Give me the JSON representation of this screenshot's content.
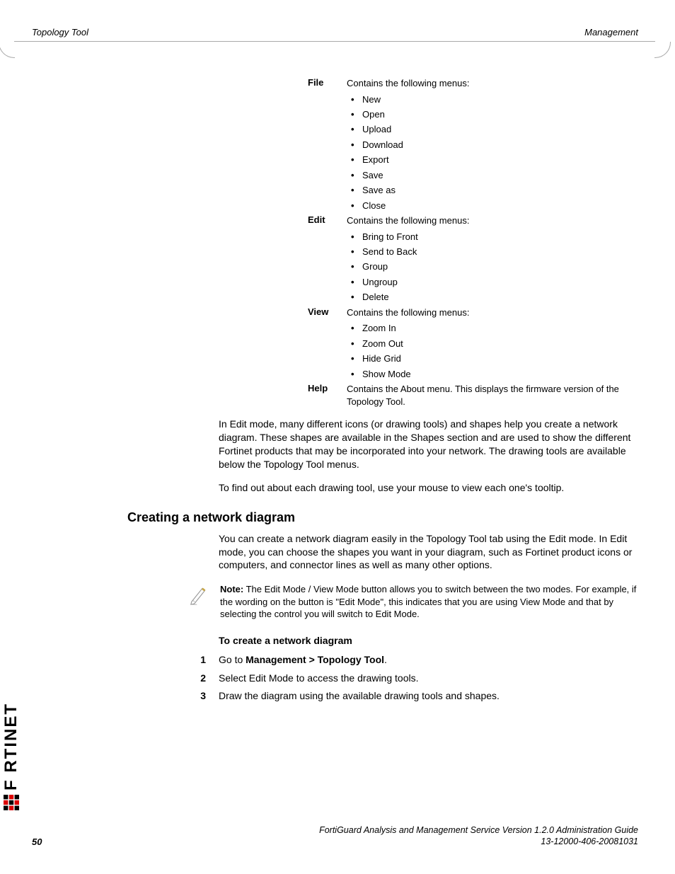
{
  "header": {
    "left": "Topology Tool",
    "right": "Management"
  },
  "menus": [
    {
      "name": "File",
      "intro": "Contains the following menus:",
      "items": [
        "New",
        "Open",
        "Upload",
        "Download",
        "Export",
        "Save",
        "Save as",
        "Close"
      ]
    },
    {
      "name": "Edit",
      "intro": "Contains the following menus:",
      "items": [
        "Bring to Front",
        "Send to Back",
        "Group",
        "Ungroup",
        "Delete"
      ]
    },
    {
      "name": "View",
      "intro": "Contains the following menus:",
      "items": [
        "Zoom In",
        "Zoom Out",
        "Hide Grid",
        "Show Mode"
      ]
    },
    {
      "name": "Help",
      "intro": "Contains the About menu. This displays the firmware version of the Topology Tool.",
      "items": []
    }
  ],
  "paragraphs": {
    "p1": "In Edit mode, many different icons (or drawing tools) and shapes help you create a network diagram. These shapes are available in the Shapes section and are used to show the different Fortinet products that may be incorporated into your network. The drawing tools are available below the Topology Tool menus.",
    "p2": "To find out about each drawing tool, use your mouse to view each one's tooltip.",
    "p3": "You can create a network diagram easily in the Topology Tool tab using the Edit mode. In Edit mode, you can choose the shapes you want in your diagram, such as Fortinet product icons or computers, and connector lines as well as many other options."
  },
  "section_heading": "Creating a network diagram",
  "note": {
    "label": "Note:",
    "text": " The Edit Mode / View Mode button allows you to switch between the two modes. For example, if the wording on the button is \"Edit Mode\", this indicates that you are using View Mode and that by selecting the control you will switch to Edit Mode."
  },
  "steps_heading": "To create a network diagram",
  "steps": [
    {
      "num": "1",
      "pre": "Go to ",
      "bold": "Management > Topology Tool",
      "post": "."
    },
    {
      "num": "2",
      "pre": "Select Edit Mode to access the drawing tools.",
      "bold": "",
      "post": ""
    },
    {
      "num": "3",
      "pre": "Draw the diagram using the available drawing tools and shapes.",
      "bold": "",
      "post": ""
    }
  ],
  "footer": {
    "line1": "FortiGuard Analysis and Management Service Version 1.2.0 Administration Guide",
    "line2": "13-12000-406-20081031",
    "page": "50"
  },
  "logo_text": "F RTINET"
}
